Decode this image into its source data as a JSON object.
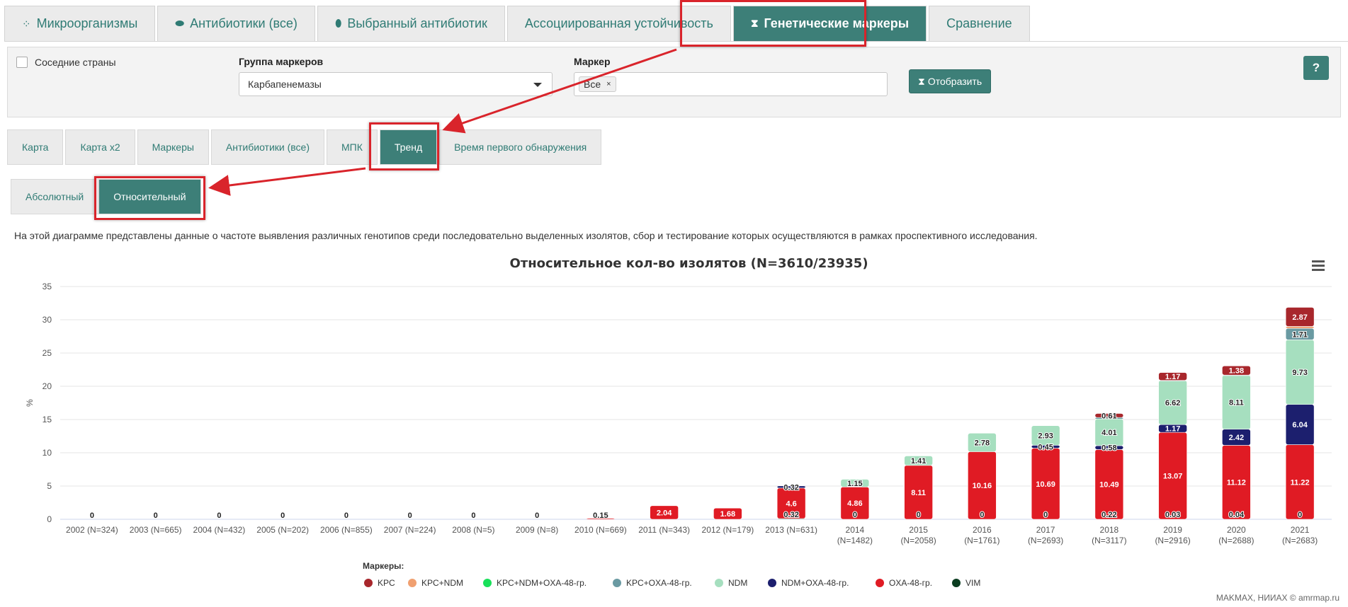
{
  "top_tabs": [
    {
      "label": "Микроорганизмы",
      "icon": "bacteria-icon"
    },
    {
      "label": "Антибиотики (все)",
      "icon": "pills-icon"
    },
    {
      "label": "Выбранный антибиотик",
      "icon": "pill-icon"
    },
    {
      "label": "Ассоциированная устойчивость",
      "icon": ""
    },
    {
      "label": "Генетические маркеры",
      "icon": "hourglass-icon"
    },
    {
      "label": "Сравнение",
      "icon": ""
    }
  ],
  "filters": {
    "neighbors_label": "Соседние страны",
    "group_label": "Группа маркеров",
    "group_value": "Карбапенемазы",
    "marker_label": "Маркер",
    "marker_tag": "Все",
    "marker_tag_remove": "×",
    "show_button": "Отобразить",
    "help_button": "?"
  },
  "sub_tabs": [
    "Карта",
    "Карта x2",
    "Маркеры",
    "Антибиотики (все)",
    "МПК",
    "Тренд",
    "Время первого обнаружения"
  ],
  "mode_tabs": [
    "Абсолютный",
    "Относительный"
  ],
  "description": "На этой диаграмме представлены данные о частоте выявления различных генотипов среди последовательно выделенных изолятов, сбор и тестирование которых осуществляются в рамках проспективного исследования.",
  "footer_credit": "MAKMAX, НИИАХ © amrmap.ru",
  "colors": {
    "accent": "#3d7f78",
    "highlight": "#d9242b"
  },
  "chart_data": {
    "type": "bar",
    "stacked": true,
    "title": "Относительное кол-во изолятов (N=3610/23935)",
    "ylabel": "%",
    "ylim": [
      0,
      35
    ],
    "yticks": [
      0,
      5,
      10,
      15,
      20,
      25,
      30,
      35
    ],
    "grid": true,
    "legend_title": "Маркеры:",
    "legend_position": "bottom",
    "categories": [
      [
        "2002 (N=324)"
      ],
      [
        "2003 (N=665)"
      ],
      [
        "2004 (N=432)"
      ],
      [
        "2005 (N=202)"
      ],
      [
        "2006 (N=855)"
      ],
      [
        "2007 (N=224)"
      ],
      [
        "2008 (N=5)"
      ],
      [
        "2009 (N=8)"
      ],
      [
        "2010 (N=669)"
      ],
      [
        "2011 (N=343)"
      ],
      [
        "2012 (N=179)"
      ],
      [
        "2013 (N=631)"
      ],
      [
        "2014",
        "(N=1482)"
      ],
      [
        "2015",
        "(N=2058)"
      ],
      [
        "2016",
        "(N=1761)"
      ],
      [
        "2017",
        "(N=2693)"
      ],
      [
        "2018",
        "(N=3117)"
      ],
      [
        "2019",
        "(N=2916)"
      ],
      [
        "2020",
        "(N=2688)"
      ],
      [
        "2021",
        "(N=2683)"
      ]
    ],
    "series": [
      {
        "name": "VIM",
        "color": "#0b3d20",
        "values": [
          0,
          0,
          0,
          0,
          0,
          0,
          0,
          0,
          0,
          0,
          0,
          0.1,
          0,
          0,
          0,
          0,
          0,
          0,
          0,
          0
        ]
      },
      {
        "name": "OXA-48-гр.",
        "color": "#e01b24",
        "values": [
          0,
          0,
          0,
          0,
          0,
          0,
          0,
          0,
          0.15,
          2.04,
          1.68,
          4.6,
          4.86,
          8.11,
          10.16,
          10.69,
          10.49,
          13.07,
          11.12,
          11.22
        ]
      },
      {
        "name": "NDM+OXA-48-гр.",
        "color": "#1c1f6e",
        "values": [
          0,
          0,
          0,
          0,
          0,
          0,
          0,
          0,
          0,
          0,
          0,
          0.32,
          0,
          0,
          0,
          0.45,
          0.58,
          1.17,
          2.42,
          6.04
        ]
      },
      {
        "name": "NDM",
        "color": "#a6dfbf",
        "values": [
          0,
          0,
          0,
          0,
          0,
          0,
          0,
          0,
          0,
          0,
          0,
          0,
          1.15,
          1.41,
          2.78,
          2.93,
          4.01,
          6.62,
          8.11,
          9.73
        ]
      },
      {
        "name": "KPC+OXA-48-гр.",
        "color": "#6a9aa2",
        "values": [
          0,
          0,
          0,
          0,
          0,
          0,
          0,
          0,
          0,
          0,
          0,
          0,
          0,
          0,
          0,
          0,
          0.22,
          0.03,
          0.04,
          1.71
        ]
      },
      {
        "name": "KPC+NDM+OXA-48-гр.",
        "color": "#19e05a",
        "values": [
          0,
          0,
          0,
          0,
          0,
          0,
          0,
          0,
          0,
          0,
          0,
          0,
          0,
          0,
          0,
          0,
          0,
          0,
          0,
          0
        ]
      },
      {
        "name": "KPC+NDM",
        "color": "#f0a070",
        "values": [
          0,
          0,
          0,
          0,
          0,
          0,
          0,
          0,
          0,
          0,
          0,
          0,
          0,
          0,
          0,
          0,
          0,
          0,
          0,
          0.3
        ]
      },
      {
        "name": "KPC",
        "color": "#a8272c",
        "values": [
          0,
          0,
          0,
          0,
          0,
          0,
          0,
          0,
          0,
          0,
          0,
          0,
          0,
          0,
          0,
          0,
          0.61,
          1.17,
          1.38,
          2.87
        ]
      }
    ],
    "data_labels": [
      [
        {
          "text": "0",
          "series": "OXA-48-гр."
        }
      ],
      [
        {
          "text": "0",
          "series": "OXA-48-гр."
        }
      ],
      [
        {
          "text": "0",
          "series": "OXA-48-гр."
        }
      ],
      [
        {
          "text": "0",
          "series": "OXA-48-гр."
        }
      ],
      [
        {
          "text": "0",
          "series": "OXA-48-гр."
        }
      ],
      [
        {
          "text": "0",
          "series": "OXA-48-гр."
        }
      ],
      [
        {
          "text": "0",
          "series": "OXA-48-гр."
        }
      ],
      [
        {
          "text": "0",
          "series": "OXA-48-гр."
        }
      ],
      [
        {
          "text": "0.15",
          "series": "OXA-48-гр."
        }
      ],
      [
        {
          "text": "2.04",
          "series": "OXA-48-гр."
        }
      ],
      [
        {
          "text": "1.68",
          "series": "OXA-48-гр."
        }
      ],
      [
        {
          "text": "0.32",
          "series": "VIM"
        },
        {
          "text": "4.6",
          "series": "OXA-48-гр."
        },
        {
          "text": "0.32",
          "series": "NDM+OXA-48-гр."
        }
      ],
      [
        {
          "text": "0",
          "series": "VIM"
        },
        {
          "text": "4.86",
          "series": "OXA-48-гр."
        },
        {
          "text": "1.15",
          "series": "NDM"
        }
      ],
      [
        {
          "text": "0",
          "series": "VIM"
        },
        {
          "text": "8.11",
          "series": "OXA-48-гр."
        },
        {
          "text": "1.41",
          "series": "NDM"
        }
      ],
      [
        {
          "text": "0",
          "series": "VIM"
        },
        {
          "text": "10.16",
          "series": "OXA-48-гр."
        },
        {
          "text": "2.78",
          "series": "NDM"
        }
      ],
      [
        {
          "text": "0",
          "series": "VIM"
        },
        {
          "text": "10.69",
          "series": "OXA-48-гр."
        },
        {
          "text": "0.45",
          "series": "NDM+OXA-48-гр."
        },
        {
          "text": "2.93",
          "series": "NDM"
        }
      ],
      [
        {
          "text": "0.22",
          "series": "VIM"
        },
        {
          "text": "10.49",
          "series": "OXA-48-гр."
        },
        {
          "text": "0.58",
          "series": "NDM+OXA-48-гр."
        },
        {
          "text": "4.01",
          "series": "NDM"
        },
        {
          "text": "0.61",
          "series": "KPC"
        }
      ],
      [
        {
          "text": "0.03",
          "series": "VIM"
        },
        {
          "text": "13.07",
          "series": "OXA-48-гр."
        },
        {
          "text": "1.17",
          "series": "NDM+OXA-48-гр."
        },
        {
          "text": "6.62",
          "series": "NDM"
        },
        {
          "text": "1.17",
          "series": "KPC"
        }
      ],
      [
        {
          "text": "0.04",
          "series": "VIM"
        },
        {
          "text": "11.12",
          "series": "OXA-48-гр."
        },
        {
          "text": "2.42",
          "series": "NDM+OXA-48-гр."
        },
        {
          "text": "8.11",
          "series": "NDM"
        },
        {
          "text": "1.38",
          "series": "KPC"
        }
      ],
      [
        {
          "text": "0",
          "series": "VIM"
        },
        {
          "text": "11.22",
          "series": "OXA-48-гр."
        },
        {
          "text": "6.04",
          "series": "NDM+OXA-48-гр."
        },
        {
          "text": "9.73",
          "series": "NDM"
        },
        {
          "text": "1.71",
          "series": "KPC+OXA-48-гр."
        },
        {
          "text": "2.87",
          "series": "KPC"
        }
      ]
    ],
    "legend": [
      {
        "name": "KPC",
        "color": "#a8272c"
      },
      {
        "name": "KPC+NDM",
        "color": "#f0a070"
      },
      {
        "name": "KPC+NDM+OXA-48-гр.",
        "color": "#19e05a"
      },
      {
        "name": "KPC+OXA-48-гр.",
        "color": "#6a9aa2"
      },
      {
        "name": "NDM",
        "color": "#a6dfbf"
      },
      {
        "name": "NDM+OXA-48-гр.",
        "color": "#1c1f6e"
      },
      {
        "name": "OXA-48-гр.",
        "color": "#e01b24"
      },
      {
        "name": "VIM",
        "color": "#0b3d20"
      }
    ]
  }
}
